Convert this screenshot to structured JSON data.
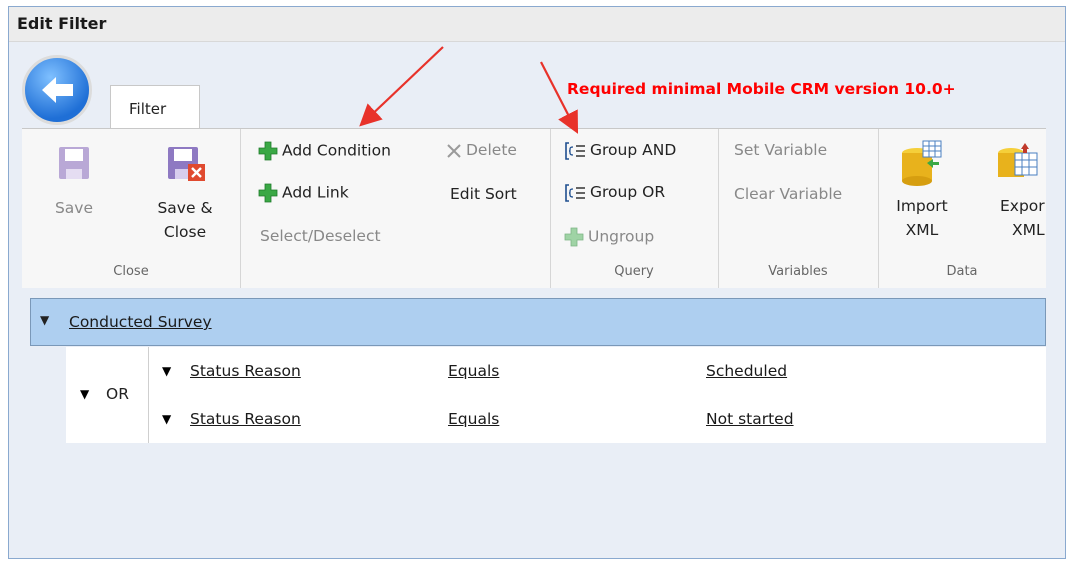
{
  "window": {
    "title": "Edit Filter"
  },
  "tabs": [
    {
      "label": "Filter"
    }
  ],
  "annotation": {
    "text": "Required minimal Mobile CRM version 10.0+",
    "color": "#ff0000"
  },
  "ribbon": {
    "close_group": {
      "label": "Close",
      "save_label": "Save",
      "save_close_label_1": "Save &",
      "save_close_label_2": "Close"
    },
    "edit_group": {
      "add_condition": "Add Condition",
      "add_link": "Add Link",
      "select_deselect": "Select/Deselect",
      "delete": "Delete",
      "edit_sort": "Edit Sort"
    },
    "query_group": {
      "label": "Query",
      "group_and": "Group AND",
      "group_or": "Group OR",
      "ungroup": "Ungroup"
    },
    "variables_group": {
      "label": "Variables",
      "set_variable": "Set Variable",
      "clear_variable": "Clear Variable"
    },
    "data_group": {
      "label": "Data",
      "import_1": "Import",
      "import_2": "XML",
      "export_1": "Expor",
      "export_2": "XML"
    }
  },
  "filter": {
    "entity": "Conducted Survey",
    "group_operator": "OR",
    "conditions": [
      {
        "field": "Status Reason",
        "operator": "Equals",
        "value": "Scheduled"
      },
      {
        "field": "Status Reason",
        "operator": "Equals",
        "value": "Not started"
      }
    ]
  },
  "colors": {
    "accent": "#aecff0",
    "plus_green": "#3aa845",
    "back_blue": "#1f6fd6"
  }
}
